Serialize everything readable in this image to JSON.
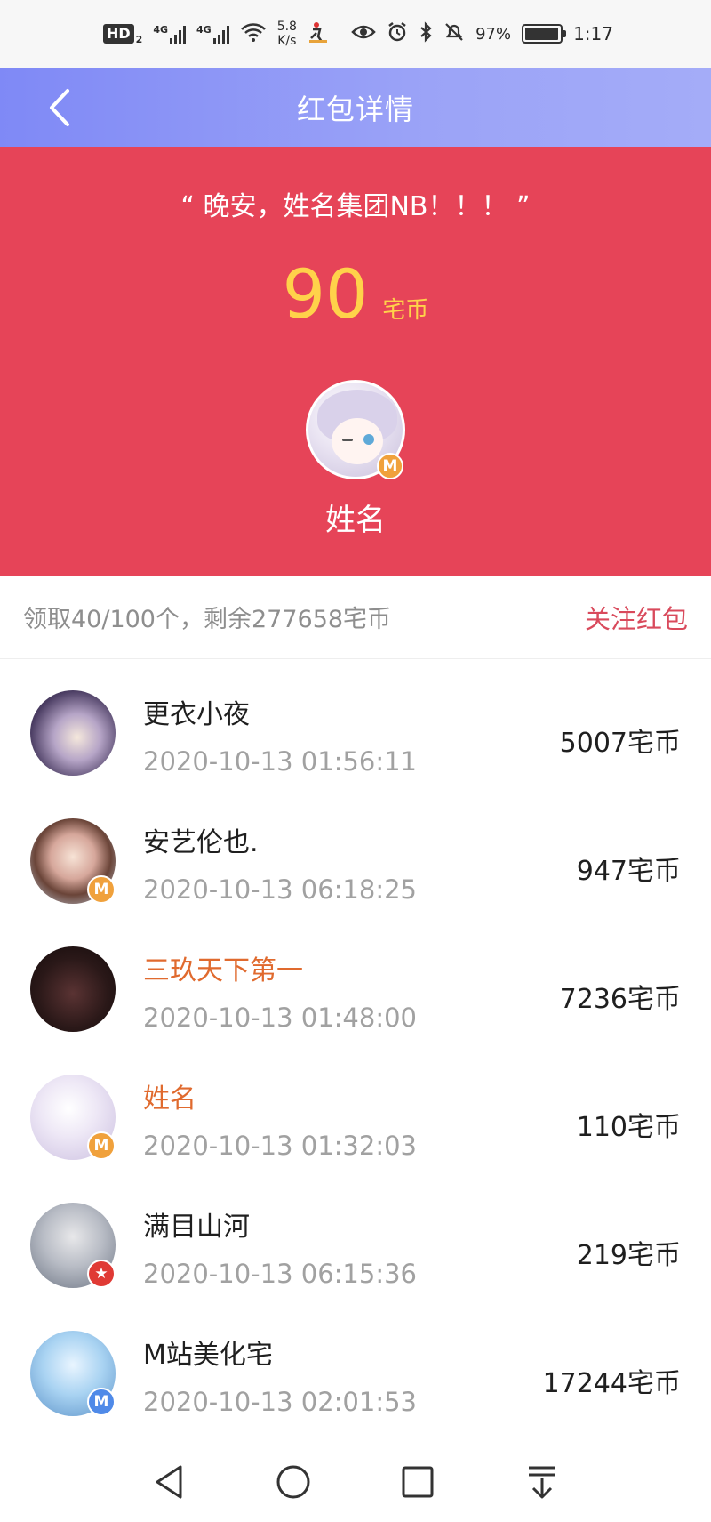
{
  "status_bar": {
    "hd_label": "HD",
    "hd_sub": "2",
    "network_1": "4G",
    "network_2": "4G",
    "speed_value": "5.8",
    "speed_unit": "K/s",
    "battery_percent": "97%",
    "battery_level": 0.97,
    "time": "1:17"
  },
  "header": {
    "title": "红包详情"
  },
  "envelope": {
    "greeting": "“ 晚安，姓名集团NB！！！ ”",
    "amount": "90",
    "amount_unit": "宅币",
    "sender_name": "姓名",
    "sender_badge": "M"
  },
  "summary": {
    "text": "领取40/100个，剩余277658宅币",
    "follow_label": "关注红包"
  },
  "recipients": [
    {
      "name": "更衣小夜",
      "time": "2020-10-13 01:56:11",
      "amount": "5007宅币"
    },
    {
      "name": "安艺伦也.",
      "time": "2020-10-13 06:18:25",
      "amount": "947宅币",
      "badge": "M"
    },
    {
      "name": "三玖天下第一",
      "time": "2020-10-13 01:48:00",
      "amount": "7236宅币"
    },
    {
      "name": "姓名",
      "time": "2020-10-13 01:32:03",
      "amount": "110宅币",
      "badge": "M"
    },
    {
      "name": "满目山河",
      "time": "2020-10-13 06:15:36",
      "amount": "219宅币",
      "badge": "★"
    },
    {
      "name": "M站美化宅",
      "time": "2020-10-13 02:01:53",
      "amount": "17244宅币",
      "badge": "M"
    }
  ],
  "colors": {
    "header_gradient_start": "#7f89f6",
    "header_gradient_end": "#a4acf8",
    "envelope_red": "#e64458",
    "amount_gold": "#ffd24a",
    "highlight_name": "#e06a2e",
    "follow_link": "#d94a5c"
  },
  "icons": {
    "back": "chevron-left-icon",
    "nav_back": "triangle-back-icon",
    "nav_home": "circle-home-icon",
    "nav_recent": "square-recent-icon",
    "nav_notifications": "pull-down-icon"
  }
}
